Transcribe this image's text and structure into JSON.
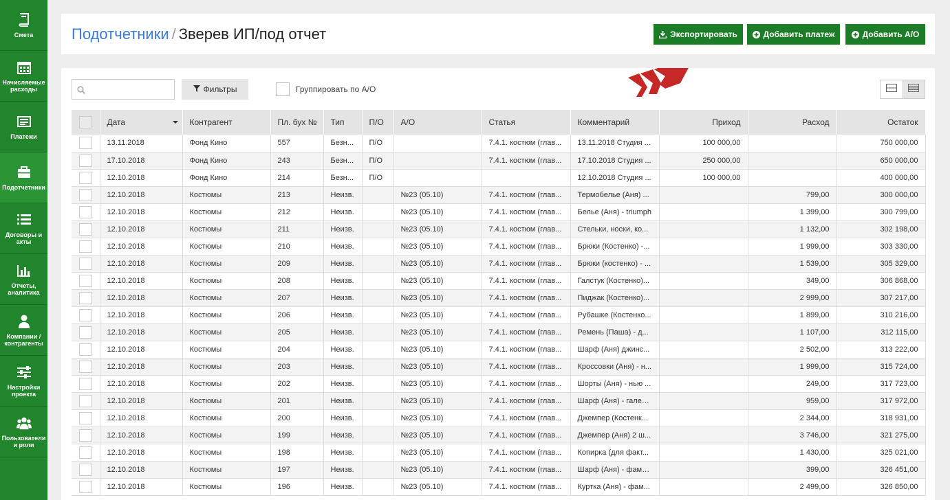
{
  "sidebar": {
    "items": [
      {
        "label": "Смета",
        "icon": "book-icon"
      },
      {
        "label": "Начисляемые расходы",
        "icon": "calendar-icon"
      },
      {
        "label": "Платежи",
        "icon": "list-icon"
      },
      {
        "label": "Подотчетники",
        "icon": "briefcase-icon"
      },
      {
        "label": "Договоры и акты",
        "icon": "list-lines-icon"
      },
      {
        "label": "Отчеты, аналитика",
        "icon": "bar-chart-icon"
      },
      {
        "label": "Компании / контрагенты",
        "icon": "user-icon"
      },
      {
        "label": "Настройки проекта",
        "icon": "sliders-icon"
      },
      {
        "label": "Пользователи и роли",
        "icon": "users-icon"
      }
    ]
  },
  "header": {
    "crumb": "Подотчетники",
    "separator": "/",
    "current": "Зверев ИП/под отчет",
    "export_label": "Экспортировать",
    "add_payment_label": "Добавить платеж",
    "add_ao_label": "Добавить А/О"
  },
  "toolbar": {
    "search_value": "",
    "filters_label": "Фильтры",
    "group_label": "Группировать по А/О"
  },
  "table": {
    "columns": [
      "Дата",
      "Контрагент",
      "Пл. бух №",
      "Тип",
      "П/О",
      "А/О",
      "Статья",
      "Комментарий",
      "Приход",
      "Расход",
      "Остаток"
    ],
    "rows": [
      [
        "13.11.2018",
        "Фонд Кино",
        "557",
        "Безн...",
        "П/О",
        "",
        "7.4.1. костюм (глав...",
        "13.11.2018 Студия ...",
        "100 000,00",
        "",
        "750 000,00"
      ],
      [
        "17.10.2018",
        "Фонд Кино",
        "243",
        "Безн...",
        "П/О",
        "",
        "7.4.1. костюм (глав...",
        "17.10.2018 Студия ...",
        "250 000,00",
        "",
        "650 000,00"
      ],
      [
        "12.10.2018",
        "Фонд Кино",
        "214",
        "Безн...",
        "П/О",
        "",
        "",
        "12.10.2018 Студия ...",
        "100 000,00",
        "",
        "400 000,00"
      ],
      [
        "12.10.2018",
        "Костюмы",
        "213",
        "Неизв.",
        "",
        "№23 (05.10)",
        "7.4.1. костюм (глав...",
        "Термобелье (Аня) ...",
        "",
        "799,00",
        "300 000,00"
      ],
      [
        "12.10.2018",
        "Костюмы",
        "212",
        "Неизв.",
        "",
        "№23 (05.10)",
        "7.4.1. костюм (глав...",
        "Белье (Аня) - triumph",
        "",
        "1 399,00",
        "300 799,00"
      ],
      [
        "12.10.2018",
        "Костюмы",
        "211",
        "Неизв.",
        "",
        "№23 (05.10)",
        "7.4.1. костюм (глав...",
        "Стельки, носки, ко...",
        "",
        "1 132,00",
        "302 198,00"
      ],
      [
        "12.10.2018",
        "Костюмы",
        "210",
        "Неизв.",
        "",
        "№23 (05.10)",
        "7.4.1. костюм (глав...",
        "Брюки (Костенко) -...",
        "",
        "1 999,00",
        "303 330,00"
      ],
      [
        "12.10.2018",
        "Костюмы",
        "209",
        "Неизв.",
        "",
        "№23 (05.10)",
        "7.4.1. костюм (глав...",
        "Брюки (костенко) - ...",
        "",
        "1 539,00",
        "305 329,00"
      ],
      [
        "12.10.2018",
        "Костюмы",
        "208",
        "Неизв.",
        "",
        "№23 (05.10)",
        "7.4.1. костюм (глав...",
        "Галстук (Костенко)...",
        "",
        "349,00",
        "306 868,00"
      ],
      [
        "12.10.2018",
        "Костюмы",
        "207",
        "Неизв.",
        "",
        "№23 (05.10)",
        "7.4.1. костюм (глав...",
        "Пиджак (Костенко)...",
        "",
        "2 999,00",
        "307 217,00"
      ],
      [
        "12.10.2018",
        "Костюмы",
        "206",
        "Неизв.",
        "",
        "№23 (05.10)",
        "7.4.1. костюм (глав...",
        "Рубашке (Костенко...",
        "",
        "1 899,00",
        "310 216,00"
      ],
      [
        "12.10.2018",
        "Костюмы",
        "205",
        "Неизв.",
        "",
        "№23 (05.10)",
        "7.4.1. костюм (глав...",
        "Ремень (Паша) - д...",
        "",
        "1 107,00",
        "312 115,00"
      ],
      [
        "12.10.2018",
        "Костюмы",
        "204",
        "Неизв.",
        "",
        "№23 (05.10)",
        "7.4.1. костюм (глав...",
        "Шарф (Аня) джинс...",
        "",
        "2 502,00",
        "313 222,00"
      ],
      [
        "12.10.2018",
        "Костюмы",
        "203",
        "Неизв.",
        "",
        "№23 (05.10)",
        "7.4.1. костюм (глав...",
        "Кроссовки (Аня) - н...",
        "",
        "1 999,00",
        "315 724,00"
      ],
      [
        "12.10.2018",
        "Костюмы",
        "202",
        "Неизв.",
        "",
        "№23 (05.10)",
        "7.4.1. костюм (глав...",
        "Шорты (Аня) - нью ...",
        "",
        "249,00",
        "317 723,00"
      ],
      [
        "12.10.2018",
        "Костюмы",
        "201",
        "Неизв.",
        "",
        "№23 (05.10)",
        "7.4.1. костюм (глав...",
        "Шарф (Аня) - галер...",
        "",
        "959,00",
        "317 972,00"
      ],
      [
        "12.10.2018",
        "Костюмы",
        "200",
        "Неизв.",
        "",
        "№23 (05.10)",
        "7.4.1. костюм (глав...",
        "Джемпер (Костенк...",
        "",
        "2 344,00",
        "318 931,00"
      ],
      [
        "12.10.2018",
        "Костюмы",
        "199",
        "Неизв.",
        "",
        "№23 (05.10)",
        "7.4.1. костюм (глав...",
        "Джемпер (Аня) 2 ш...",
        "",
        "3 746,00",
        "321 275,00"
      ],
      [
        "12.10.2018",
        "Костюмы",
        "198",
        "Неизв.",
        "",
        "№23 (05.10)",
        "7.4.1. костюм (глав...",
        "Копирка (для факт...",
        "",
        "1 430,00",
        "325 021,00"
      ],
      [
        "12.10.2018",
        "Костюмы",
        "197",
        "Неизв.",
        "",
        "№23 (05.10)",
        "7.4.1. костюм (глав...",
        "Шарф (Аня) - фами...",
        "",
        "399,00",
        "326 451,00"
      ],
      [
        "12.10.2018",
        "Костюмы",
        "196",
        "Неизв.",
        "",
        "№23 (05.10)",
        "7.4.1. костюм (глав...",
        "Куртка (Аня) - фам...",
        "",
        "2 499,00",
        "326 850,00"
      ]
    ]
  },
  "colors": {
    "sidebar": "#21852c",
    "button": "#1c7d27",
    "accent_link": "#3a7bd5",
    "arrow": "#c62828"
  }
}
